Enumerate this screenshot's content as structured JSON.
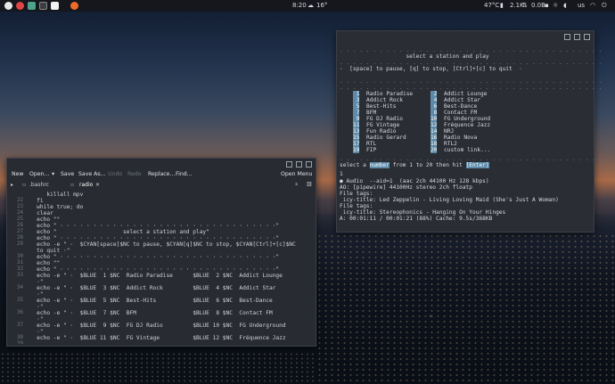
{
  "panel": {
    "clock": "8:20",
    "weather": "16°",
    "cpu_temp": "47°C",
    "net": "2.1K",
    "disk": "0.0B",
    "lang": "us"
  },
  "terminal": {
    "lines": [
      {
        "t": ". . . . . . . . . . . . . . . . . . . . . . . . . . . . . . . . . . . . . . . .",
        "y": 52
      },
      {
        "t": "                    select a station and play",
        "y": 60
      },
      {
        "t": ". . . . . . . . . . . . . . . . . . . . . . . . . . . . . . . . . . . . . . . .",
        "y": 67
      },
      {
        "t": "",
        "y": 74
      },
      {
        "t": "·  [space] to pause, [q] to stop, [Ctrl]+[c] to quit  ·",
        "y": 74
      },
      {
        "t": "",
        "y": 81
      },
      {
        "t": ". . . . . . . . . . . . . . . . . . . . . . . . . . . . . . . . . . . . . . . .",
        "y": 88
      }
    ],
    "stations_left": [
      {
        "n": "1",
        "name": "Radio Paradise"
      },
      {
        "n": "3",
        "name": "Addict Rock"
      },
      {
        "n": "5",
        "name": "Best-Hits"
      },
      {
        "n": "7",
        "name": "BFM"
      },
      {
        "n": "9",
        "name": "FG DJ Radio"
      },
      {
        "n": "11",
        "name": "FG Vintage"
      },
      {
        "n": "13",
        "name": "Fun Radio"
      },
      {
        "n": "15",
        "name": "Radio Gerard"
      },
      {
        "n": "17",
        "name": "RTL"
      },
      {
        "n": "19",
        "name": "FIP"
      }
    ],
    "stations_right": [
      {
        "n": "2",
        "name": "Addict Lounge"
      },
      {
        "n": "4",
        "name": "Addict Star"
      },
      {
        "n": "6",
        "name": "Best-Dance"
      },
      {
        "n": "8",
        "name": "Contact FM"
      },
      {
        "n": "10",
        "name": "FG Underground"
      },
      {
        "n": "12",
        "name": "Fréquence Jazz"
      },
      {
        "n": "14",
        "name": "NRJ"
      },
      {
        "n": "16",
        "name": "Radio Nova"
      },
      {
        "n": "18",
        "name": "RTL2"
      },
      {
        "n": "20",
        "name": "custom link..."
      }
    ],
    "prompt_a": "select a ",
    "prompt_number": "number",
    "prompt_b": " from 1 to 20 then hit ",
    "prompt_enter": "[Enter]",
    "input": "1",
    "output": [
      "● Audio  --aid=1  (aac 2ch 44100 Hz 128 kbps)",
      "AO: [pipewire] 44100Hz stereo 2ch floatp",
      "File tags:",
      " icy-title: Led Zeppelin - Living Loving Maid (She's Just A Woman)",
      "File tags:",
      " icy-title: Stereophonics - Hanging On Your Hinges",
      "A: 00:01:11 / 00:01:21 (88%) Cache: 9.5s/368KB"
    ]
  },
  "editor": {
    "toolbar": {
      "new": "New",
      "open": "Open...",
      "save": "Save",
      "save_as": "Save As...",
      "undo": "Undo",
      "redo": "Redo",
      "replace": "Replace...",
      "find": "Find...",
      "open_menu": "Open Menu"
    },
    "tabs": [
      {
        "label": ".bashrc"
      },
      {
        "label": "radio"
      }
    ],
    "lines": [
      {
        "n": "",
        "code": "      killall mpv"
      },
      {
        "n": "22",
        "code": "   fi"
      },
      {
        "n": "23",
        "code": "   while true; do"
      },
      {
        "n": "24",
        "code": "   clear"
      },
      {
        "n": "25",
        "code": "   echo \"\""
      },
      {
        "n": "26",
        "code": "   echo \" · · · · · · · · · · · · · · · · · · · · · · · · · · · · · · · · ·\""
      },
      {
        "n": "27",
        "code": "   echo \"                    select a station and play\""
      },
      {
        "n": "28",
        "code": "   echo \" · · · · · · · · · · · · · · · · · · · · · · · · · · · · · · · · ·\""
      },
      {
        "n": "29",
        "code": "   echo -e \" ·  $CYAN[space]$NC to pause, $CYAN[q]$NC to stop, $CYAN[Ctrl]+[c]$NC"
      },
      {
        "n": "",
        "code": "   to quit ·\""
      },
      {
        "n": "30",
        "code": "   echo \" · · · · · · · · · · · · · · · · · · · · · · · · · · · · · · · · ·\""
      },
      {
        "n": "31",
        "code": "   echo \"\""
      },
      {
        "n": "32",
        "code": "   echo \" · · · · · · · · · · · · · · · · · · · · · · · · · · · · · · · · ·\""
      },
      {
        "n": "33",
        "code": "   echo -e \" ·  $BLUE  1 $NC  Radio Paradise      $BLUE  2 $NC  Addict Lounge"
      },
      {
        "n": "",
        "code": "   ·\""
      },
      {
        "n": "34",
        "code": "   echo -e \" ·  $BLUE  3 $NC  Addict Rock         $BLUE  4 $NC  Addict Star"
      },
      {
        "n": "",
        "code": "   ·\""
      },
      {
        "n": "35",
        "code": "   echo -e \" ·  $BLUE  5 $NC  Best-Hits           $BLUE  6 $NC  Best-Dance"
      },
      {
        "n": "",
        "code": "   ·\""
      },
      {
        "n": "36",
        "code": "   echo -e \" ·  $BLUE  7 $NC  BFM                 $BLUE  8 $NC  Contact FM"
      },
      {
        "n": "",
        "code": "   ·\""
      },
      {
        "n": "37",
        "code": "   echo -e \" ·  $BLUE  9 $NC  FG DJ Radio         $BLUE 10 $NC  FG Underground"
      },
      {
        "n": "",
        "code": "   ·\""
      },
      {
        "n": "38",
        "code": "   echo -e \" ·  $BLUE 11 $NC  FG Vintage          $BLUE 12 $NC  Fréquence Jazz"
      },
      {
        "n": "39",
        "code": ""
      }
    ]
  }
}
